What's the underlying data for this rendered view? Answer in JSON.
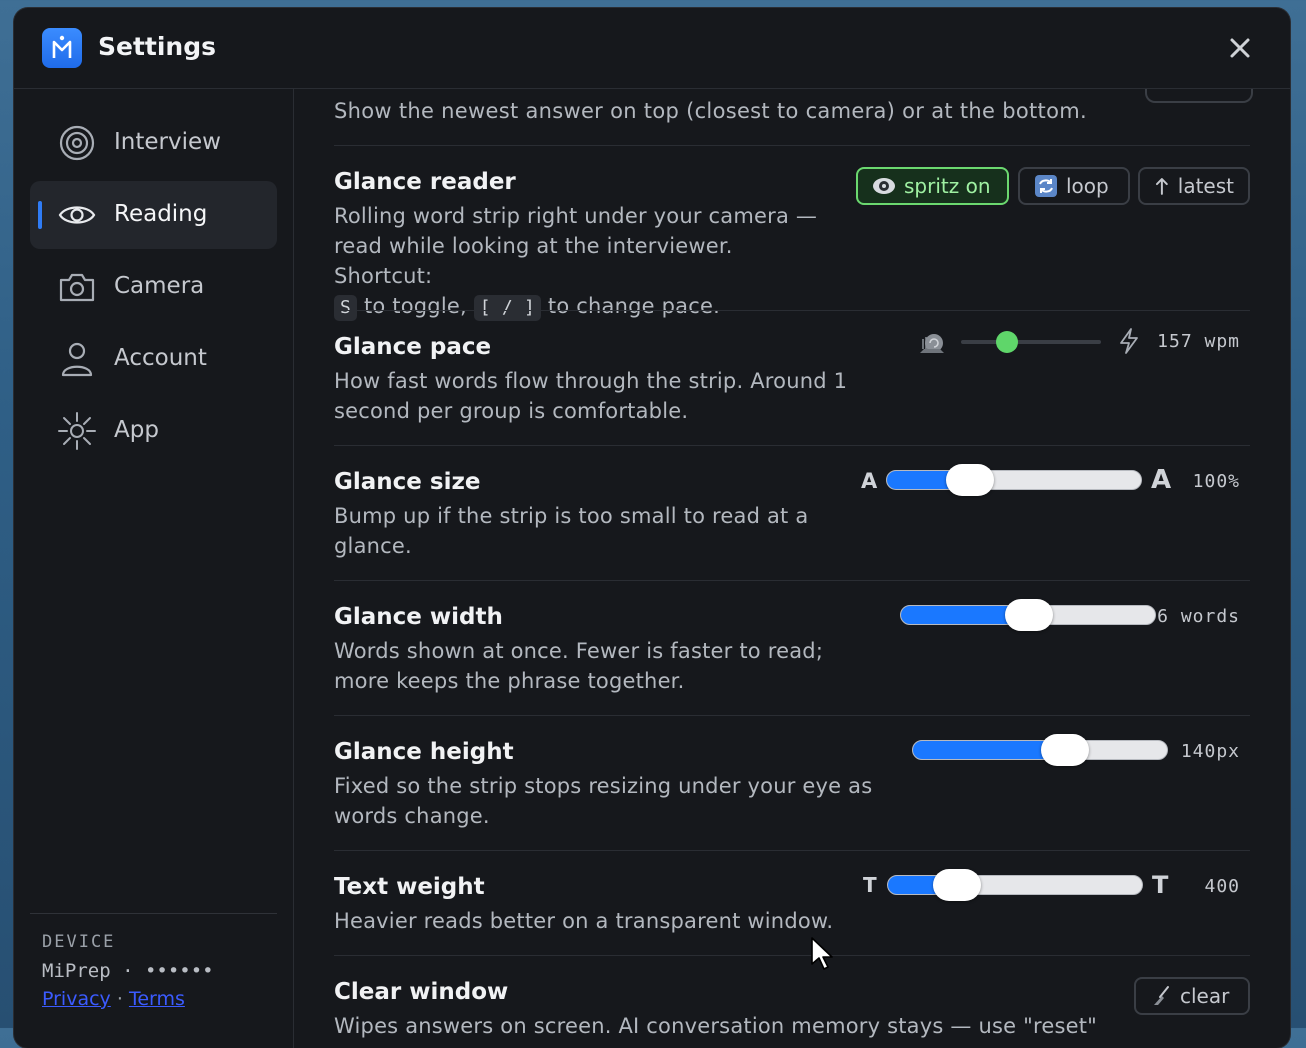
{
  "window": {
    "title": "Settings",
    "logo_glyph": "M",
    "close_icon": "close-icon"
  },
  "sidebar": {
    "items": [
      {
        "label": "Interview",
        "icon": "target-icon",
        "active": false
      },
      {
        "label": "Reading",
        "icon": "eye-icon",
        "active": true
      },
      {
        "label": "Camera",
        "icon": "camera-icon",
        "active": false
      },
      {
        "label": "Account",
        "icon": "user-icon",
        "active": false
      },
      {
        "label": "App",
        "icon": "sun-icon",
        "active": false
      }
    ],
    "device": {
      "heading": "DEVICE",
      "name": "MiPrep · ••••••",
      "privacy_link": "Privacy",
      "separator": "·",
      "terms_link": "Terms"
    }
  },
  "settings": {
    "top_partial_desc": "Show the newest answer on top (closest to camera) or at the bottom.",
    "glance_reader": {
      "title": "Glance reader",
      "desc_1": "Rolling word strip right under your camera — read while looking at the interviewer. Shortcut:",
      "key_toggle": "S",
      "desc_2": "to toggle,",
      "key_pace_1": "[",
      "key_sep": "/",
      "key_pace_2": "]",
      "desc_3": "to change pace.",
      "buttons": [
        {
          "label": "spritz on",
          "icon": "eye-icon",
          "on": true
        },
        {
          "label": "loop",
          "icon": "loop-icon",
          "on": false
        },
        {
          "label": "latest",
          "icon": "arrow-up-icon",
          "on": false
        }
      ]
    },
    "glance_pace": {
      "title": "Glance pace",
      "desc": "How fast words flow through the strip. Around 1 second per group is comfortable.",
      "value_label": "157 wpm",
      "level": 0.33,
      "slow_icon": "snail-icon",
      "fast_icon": "lightning-icon"
    },
    "glance_size": {
      "title": "Glance size",
      "desc": "Bump up if the strip is too small to read at a glance.",
      "min_letter": "A",
      "max_letter": "A",
      "value_label": "100%",
      "level": 0.31
    },
    "glance_width": {
      "title": "Glance width",
      "desc": "Words shown at once. Fewer is faster to read; more keeps the phrase together.",
      "value_label": "6 words",
      "level": 0.5
    },
    "glance_height": {
      "title": "Glance height",
      "desc": "Fixed so the strip stops resizing under your eye as words change.",
      "value_label": "140px",
      "level": 0.6
    },
    "text_weight": {
      "title": "Text weight",
      "desc": "Heavier reads better on a transparent window.",
      "min_letter": "T",
      "max_letter": "T",
      "value_label": "400",
      "level": 0.25
    },
    "clear_window": {
      "title": "Clear window",
      "desc": "Wipes answers on screen. AI conversation memory stays — use \"reset\"",
      "button_label": "clear",
      "button_icon": "broom-icon"
    }
  }
}
